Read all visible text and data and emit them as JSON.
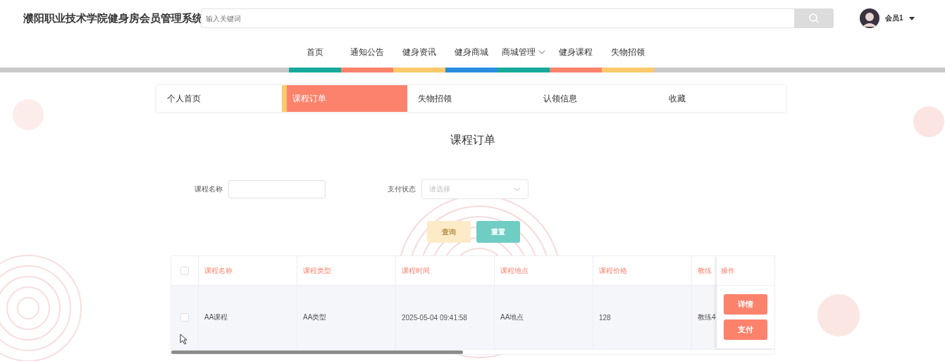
{
  "header": {
    "site_title": "濮阳职业技术学院健身房会员管理系统",
    "search": {
      "placeholder": "输入关键词"
    },
    "user": {
      "name": "会员1"
    }
  },
  "nav": [
    {
      "label": "首页",
      "color": "#16a99a",
      "has_menu": false
    },
    {
      "label": "通知公告",
      "color": "#fc826c",
      "has_menu": false
    },
    {
      "label": "健身资讯",
      "color": "#fcc96b",
      "has_menu": false
    },
    {
      "label": "健身商城",
      "color": "#2a8ee0",
      "has_menu": false
    },
    {
      "label": "商城管理",
      "color": "#16a99a",
      "has_menu": true
    },
    {
      "label": "健身课程",
      "color": "#fc826c",
      "has_menu": false
    },
    {
      "label": "失物招领",
      "color": "#fcc96b",
      "has_menu": false
    }
  ],
  "tabs": [
    {
      "label": "个人首页",
      "selected": false
    },
    {
      "label": "课程订单",
      "selected": true
    },
    {
      "label": "失物招领",
      "selected": false
    },
    {
      "label": "认领信息",
      "selected": false
    },
    {
      "label": "收藏",
      "selected": false
    }
  ],
  "page_title": "课程订单",
  "filters": [
    {
      "kind": "text",
      "label": "课程名称"
    },
    {
      "kind": "select",
      "label": "支付状态",
      "placeholder": "请选择"
    }
  ],
  "buttons": [
    {
      "label": "查询",
      "disabled": true
    },
    {
      "label": "重置",
      "disabled": false
    }
  ],
  "table": {
    "select_all": {
      "checked": false
    },
    "columns": [
      "课程名称",
      "课程类型",
      "课程时间",
      "课程地点",
      "课程价格",
      "教练"
    ],
    "action_column": "操作",
    "rows": [
      {
        "checked": false,
        "cells": [
          "AA课程",
          "AA类型",
          "2025-05-04 09:41:58",
          "AA地点",
          "128",
          "教练4"
        ],
        "actions": [
          "详情",
          "支付"
        ]
      }
    ]
  }
}
